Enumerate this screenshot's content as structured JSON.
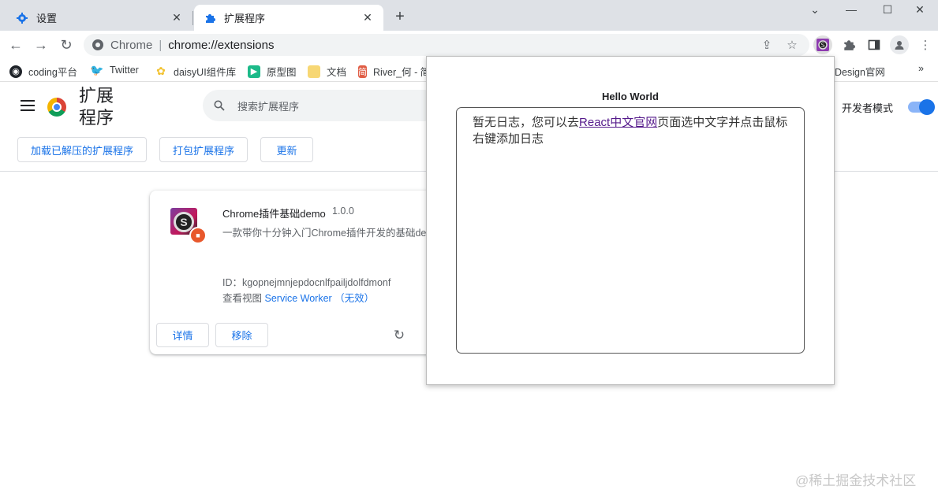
{
  "tabs": [
    {
      "title": "设置",
      "icon": "gear-icon"
    },
    {
      "title": "扩展程序",
      "icon": "puzzle-icon"
    }
  ],
  "omnibox": {
    "host": "Chrome",
    "path": "chrome://extensions"
  },
  "bookmarks": [
    {
      "label": "coding平台",
      "icon": "coding-icon",
      "color": "#1f2329"
    },
    {
      "label": "Twitter",
      "icon": "twitter-icon",
      "color": "#1d9bf0"
    },
    {
      "label": "daisyUI组件库",
      "icon": "daisyui-icon",
      "color": "#f2c230"
    },
    {
      "label": "原型图",
      "icon": "prototype-icon",
      "color": "#1cba89"
    },
    {
      "label": "文档",
      "icon": "folder-icon",
      "color": "#f7d774"
    },
    {
      "label": "River_何 - 简",
      "icon": "jianshu-icon",
      "color": "#e05d45"
    },
    {
      "label": "Design官网",
      "icon": "",
      "color": ""
    }
  ],
  "header": {
    "title": "扩展程序",
    "search_placeholder": "搜索扩展程序",
    "dev_mode_label": "开发者模式",
    "dev_mode_enabled": true
  },
  "actions": {
    "load_unpacked": "加载已解压的扩展程序",
    "pack": "打包扩展程序",
    "update": "更新"
  },
  "extension": {
    "name": "Chrome插件基础demo",
    "version": "1.0.0",
    "description": "一款带你十分钟入门Chrome插件开发的基础demo",
    "id": "ID：kgopnejmnjepdocnlfpailjdolfdmonf",
    "views_prefix": "查看视图",
    "service_worker": "Service Worker （无效）",
    "details": "详情",
    "remove": "移除"
  },
  "popup": {
    "title": "Hello World",
    "log_text_before": "暂无日志，您可以去",
    "log_link": "React中文官网",
    "log_text_after": "页面选中文字并点击鼠标右键添加日志"
  },
  "watermark": "@稀土掘金技术社区",
  "colors": {
    "accent": "#1a73e8",
    "tabstrip": "#dee1e6"
  }
}
